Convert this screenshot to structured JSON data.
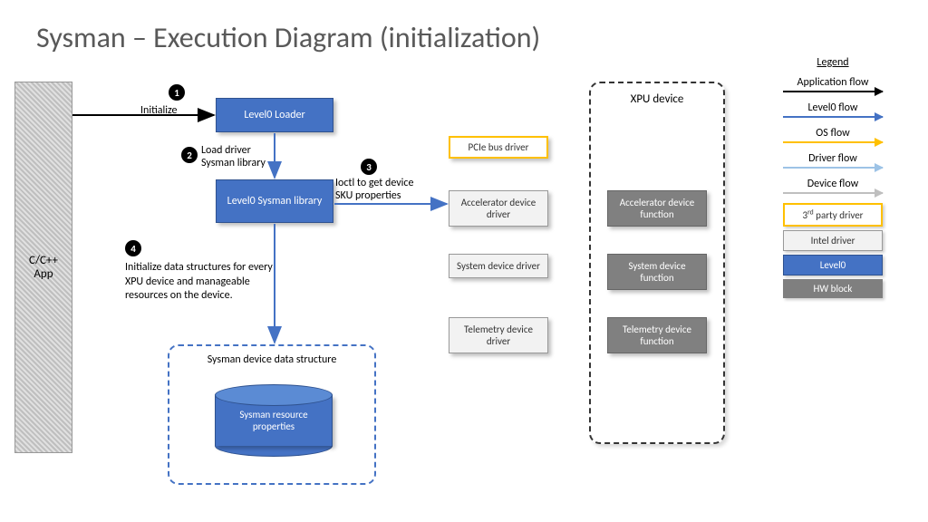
{
  "title": "Sysman – Execution Diagram (initialization)",
  "app_block": "C/C++\nApp",
  "steps": {
    "s1": {
      "num": "1",
      "label": "Initialize"
    },
    "s2": {
      "num": "2",
      "label": "Load driver\nSysman library"
    },
    "s3": {
      "num": "3",
      "label": "Ioctl to get device\nSKU properties"
    },
    "s4": {
      "num": "4",
      "label": "Initialize data structures for every XPU device and manageable resources on the device."
    }
  },
  "boxes": {
    "loader": "Level0 Loader",
    "sysman_lib": "Level0 Sysman library",
    "pcie": "PCIe bus driver",
    "accel_drv": "Accelerator device driver",
    "sys_drv": "System device driver",
    "tel_drv": "Telemetry device driver",
    "accel_fn": "Accelerator device function",
    "sys_fn": "System device function",
    "tel_fn": "Telemetry device function"
  },
  "xpu_title": "XPU device",
  "datastruct": {
    "title": "Sysman device data structure",
    "cylinder": "Sysman resource properties"
  },
  "legend": {
    "title": "Legend",
    "app_flow": "Application flow",
    "l0_flow": "Level0 flow",
    "os_flow": "OS flow",
    "drv_flow": "Driver flow",
    "dev_flow": "Device flow",
    "third": "3rd party driver",
    "intel": "Intel driver",
    "level0": "Level0",
    "hw": "HW block"
  }
}
